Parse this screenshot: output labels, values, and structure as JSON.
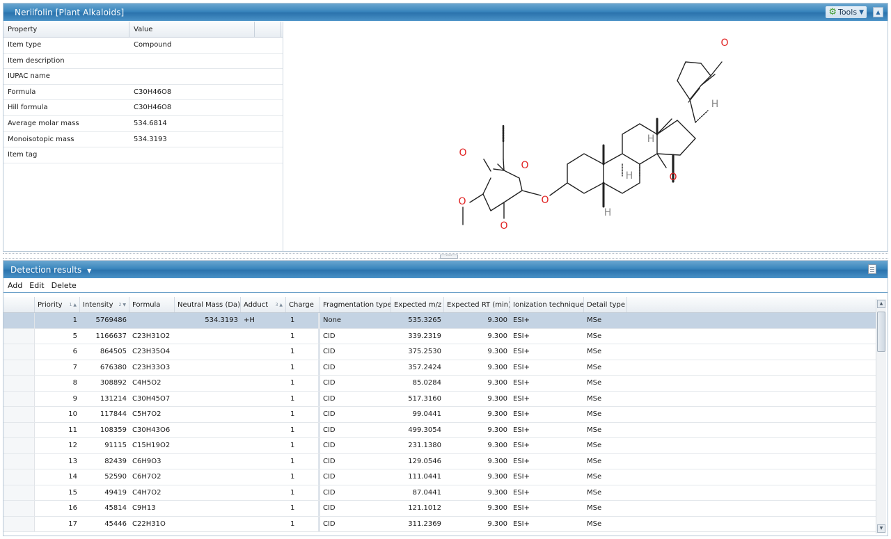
{
  "window": {
    "title": "Neriifolin  [Plant Alkaloids]",
    "tools_label": "Tools"
  },
  "properties": {
    "headers": [
      "Property",
      "Value"
    ],
    "rows": [
      {
        "property": "Item type",
        "value": "Compound"
      },
      {
        "property": "Item description",
        "value": ""
      },
      {
        "property": "IUPAC name",
        "value": ""
      },
      {
        "property": "Formula",
        "value": "C30H46O8"
      },
      {
        "property": "Hill formula",
        "value": "C30H46O8"
      },
      {
        "property": "Average molar mass",
        "value": "534.6814"
      },
      {
        "property": "Monoisotopic mass",
        "value": "534.3193"
      },
      {
        "property": "Item tag",
        "value": ""
      }
    ]
  },
  "structure": {
    "atom_labels": [
      "O",
      "O",
      "H",
      "H",
      "H",
      "O",
      "H",
      "O",
      "O",
      "O",
      "O"
    ]
  },
  "detection": {
    "title": "Detection results",
    "actions": {
      "add": "Add",
      "edit": "Edit",
      "delete": "Delete"
    },
    "columns": [
      "Priority",
      "Intensity",
      "Formula",
      "Neutral Mass (Da)",
      "Adduct",
      "Charge",
      "Fragmentation type",
      "Expected m/z",
      "Expected RT (min)",
      "Ionization technique",
      "Detail type"
    ],
    "sort_markers": {
      "priority": "1",
      "intensity": "2",
      "adduct": "3"
    },
    "rows": [
      [
        "1",
        "5769486",
        "",
        "534.3193",
        "+H",
        "1",
        "None",
        "535.3265",
        "9.300",
        "ESI+",
        "MSe"
      ],
      [
        "5",
        "1166637",
        "C23H31O2",
        "",
        "",
        "1",
        "CID",
        "339.2319",
        "9.300",
        "ESI+",
        "MSe"
      ],
      [
        "6",
        "864505",
        "C23H35O4",
        "",
        "",
        "1",
        "CID",
        "375.2530",
        "9.300",
        "ESI+",
        "MSe"
      ],
      [
        "7",
        "676380",
        "C23H33O3",
        "",
        "",
        "1",
        "CID",
        "357.2424",
        "9.300",
        "ESI+",
        "MSe"
      ],
      [
        "8",
        "308892",
        "C4H5O2",
        "",
        "",
        "1",
        "CID",
        "85.0284",
        "9.300",
        "ESI+",
        "MSe"
      ],
      [
        "9",
        "131214",
        "C30H45O7",
        "",
        "",
        "1",
        "CID",
        "517.3160",
        "9.300",
        "ESI+",
        "MSe"
      ],
      [
        "10",
        "117844",
        "C5H7O2",
        "",
        "",
        "1",
        "CID",
        "99.0441",
        "9.300",
        "ESI+",
        "MSe"
      ],
      [
        "11",
        "108359",
        "C30H43O6",
        "",
        "",
        "1",
        "CID",
        "499.3054",
        "9.300",
        "ESI+",
        "MSe"
      ],
      [
        "12",
        "91115",
        "C15H19O2",
        "",
        "",
        "1",
        "CID",
        "231.1380",
        "9.300",
        "ESI+",
        "MSe"
      ],
      [
        "13",
        "82439",
        "C6H9O3",
        "",
        "",
        "1",
        "CID",
        "129.0546",
        "9.300",
        "ESI+",
        "MSe"
      ],
      [
        "14",
        "52590",
        "C6H7O2",
        "",
        "",
        "1",
        "CID",
        "111.0441",
        "9.300",
        "ESI+",
        "MSe"
      ],
      [
        "15",
        "49419",
        "C4H7O2",
        "",
        "",
        "1",
        "CID",
        "87.0441",
        "9.300",
        "ESI+",
        "MSe"
      ],
      [
        "16",
        "45814",
        "C9H13",
        "",
        "",
        "1",
        "CID",
        "121.1012",
        "9.300",
        "ESI+",
        "MSe"
      ],
      [
        "17",
        "45446",
        "C22H31O",
        "",
        "",
        "1",
        "CID",
        "311.2369",
        "9.300",
        "ESI+",
        "MSe"
      ]
    ]
  },
  "colors": {
    "title_bar": "#3a86bd",
    "selected_row": "#c4d3e3",
    "oxygen": "#e02020",
    "hydrogen": "#8a8a8a"
  }
}
